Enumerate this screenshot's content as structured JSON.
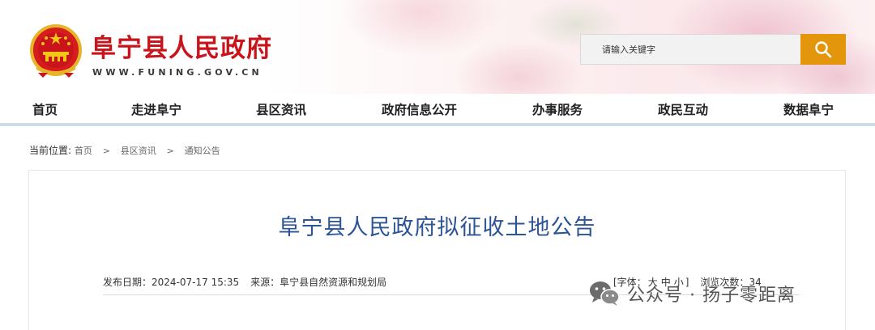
{
  "header": {
    "site_name": "阜宁县人民政府",
    "site_url": "WWW.FUNING.GOV.CN",
    "logo_name": "national-emblem",
    "search": {
      "placeholder": "请输入关键字",
      "value": "",
      "button_icon": "search-icon"
    }
  },
  "colors": {
    "brand_red": "#c8141a",
    "search_button": "#e3960b",
    "title_blue": "#2c5496",
    "nav_underline": "#cfdbe6"
  },
  "nav": {
    "items": [
      {
        "label": "首页"
      },
      {
        "label": "走进阜宁"
      },
      {
        "label": "县区资讯"
      },
      {
        "label": "政府信息公开"
      },
      {
        "label": "办事服务"
      },
      {
        "label": "政民互动"
      },
      {
        "label": "数据阜宁"
      }
    ]
  },
  "breadcrumb": {
    "prefix": "当前位置:",
    "items": [
      "首页",
      "县区资讯",
      "通知公告"
    ],
    "separator": ">"
  },
  "article": {
    "title": "阜宁县人民政府拟征收土地公告",
    "publish_label": "发布日期：",
    "publish_date": "2024-07-17 15:35",
    "source_label": "来源：",
    "source": "阜宁县自然资源和规划局",
    "font_label": "[字体：",
    "font_large": "大",
    "font_medium": "中",
    "font_small": "小",
    "font_close": "]",
    "views_label": "浏览次数：",
    "views": "34"
  },
  "watermark": {
    "prefix": "公众号",
    "dot": "·",
    "name": "扬子零距离",
    "icon": "wechat-icon"
  }
}
